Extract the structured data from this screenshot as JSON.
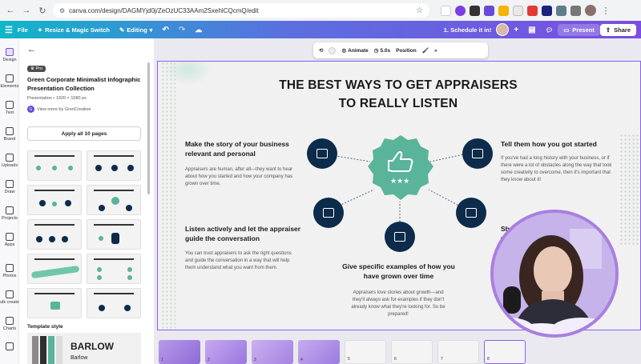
{
  "browser": {
    "url": "canva.com/design/DAGMYjd0j/ZeOzUC33AAm2SxehlCQcmQ/edit"
  },
  "topbar": {
    "file": "File",
    "resize": "Resize & Magic Switch",
    "editing": "Editing",
    "schedule": "1. Schedule it in!",
    "present": "Present",
    "share": "Share"
  },
  "rail": {
    "items": [
      "Design",
      "Elements",
      "Text",
      "Brand",
      "Uploads",
      "Draw",
      "Projects",
      "Apps",
      "Photos",
      "ulk create",
      "Charts"
    ]
  },
  "panel": {
    "badge": "Pro",
    "title": "Green Corporate Minimalist Infographic Presentation Collection",
    "meta": "Presentation • 1920 × 1080 px",
    "author": "View more by GrenCreative",
    "apply": "Apply all 10 pages",
    "style_heading": "Template style",
    "style_name": "BARLOW",
    "style_sub": "Barlow"
  },
  "toolbar": {
    "animate": "Animate",
    "duration": "5.0s",
    "position": "Position"
  },
  "slide": {
    "title": "THE BEST WAYS TO GET APPRAISERS TO REALLY LISTEN",
    "b1_h": "Make the story of your business relevant and personal",
    "b1_p": "Appraisers are human, after all—they want to hear about how you started and how your company has grown over time.",
    "b2_h": "Listen actively and let the appraiser guide the conversation",
    "b2_p": "You can trust appraisers to ask the right questions and guide the conversation in a way that will help them understand what you want from them.",
    "b3_h": "Give specific examples of how you have grown over time",
    "b3_p": "Appraisers love stories about growth—and they'll always ask for examples if they don't already know what they're looking for. So be prepared!",
    "b4_h": "Tell them how you got started",
    "b4_p": "If you've had a long history with your business, or if there were a lot of obstacles along the way that took some creativity to overcome, then it's important that they know about it!",
    "b5_h": "Show",
    "b5_h2": "w"
  },
  "filmstrip": {
    "pages": [
      "1",
      "2",
      "3",
      "4",
      "5",
      "6",
      "7",
      "8"
    ]
  },
  "colors": {
    "navy": "#0d2b4a",
    "green": "#5ab49a",
    "accent": "#8b5cf6"
  }
}
